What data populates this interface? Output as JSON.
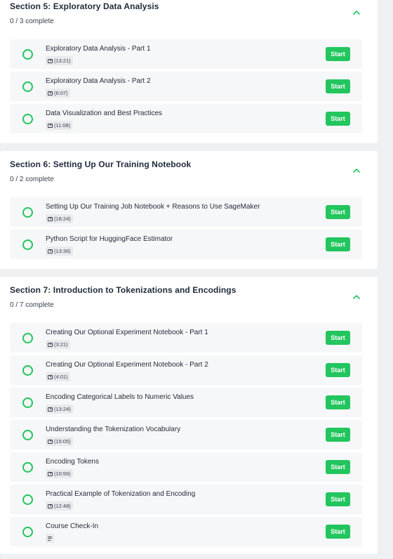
{
  "colors": {
    "accent": "#22c55e",
    "page_bg": "#eef0f2",
    "card_bg": "#ffffff",
    "lesson_bg": "#f6f7f8"
  },
  "sections": [
    {
      "title": "Section 5: Exploratory Data Analysis",
      "progress": "0 / 3 complete",
      "expanded": true,
      "lessons": [
        {
          "title": "Exploratory Data Analysis - Part 1",
          "duration": "(13:21)",
          "icon": "video-icon",
          "button": "Start"
        },
        {
          "title": "Exploratory Data Analysis - Part 2",
          "duration": "(6:07)",
          "icon": "video-icon",
          "button": "Start"
        },
        {
          "title": "Data Visualization and Best Practices",
          "duration": "(11:08)",
          "icon": "video-icon",
          "button": "Start"
        }
      ]
    },
    {
      "title": "Section 6: Setting Up Our Training Notebook",
      "progress": "0 / 2 complete",
      "expanded": true,
      "lessons": [
        {
          "title": "Setting Up Our Training Job Notebook + Reasons to Use SageMaker",
          "duration": "(18:24)",
          "icon": "video-icon",
          "button": "Start"
        },
        {
          "title": "Python Script for HuggingFace Estimator",
          "duration": "(13:36)",
          "icon": "video-icon",
          "button": "Start"
        }
      ]
    },
    {
      "title": "Section 7: Introduction to Tokenizations and Encodings",
      "progress": "0 / 7 complete",
      "expanded": true,
      "lessons": [
        {
          "title": "Creating Our Optional Experiment Notebook - Part 1",
          "duration": "(3:21)",
          "icon": "video-icon",
          "button": "Start"
        },
        {
          "title": "Creating Our Optional Experiment Notebook - Part 2",
          "duration": "(4:01)",
          "icon": "video-icon",
          "button": "Start"
        },
        {
          "title": "Encoding Categorical Labels to Numeric Values",
          "duration": "(13:24)",
          "icon": "video-icon",
          "button": "Start"
        },
        {
          "title": "Understanding the Tokenization Vocabulary",
          "duration": "(15:05)",
          "icon": "video-icon",
          "button": "Start"
        },
        {
          "title": "Encoding Tokens",
          "duration": "(10:56)",
          "icon": "video-icon",
          "button": "Start"
        },
        {
          "title": "Practical Example of Tokenization and Encoding",
          "duration": "(12:48)",
          "icon": "video-icon",
          "button": "Start"
        },
        {
          "title": "Course Check-In",
          "duration": "",
          "icon": "text-lesson-icon",
          "button": "Start"
        }
      ]
    }
  ]
}
